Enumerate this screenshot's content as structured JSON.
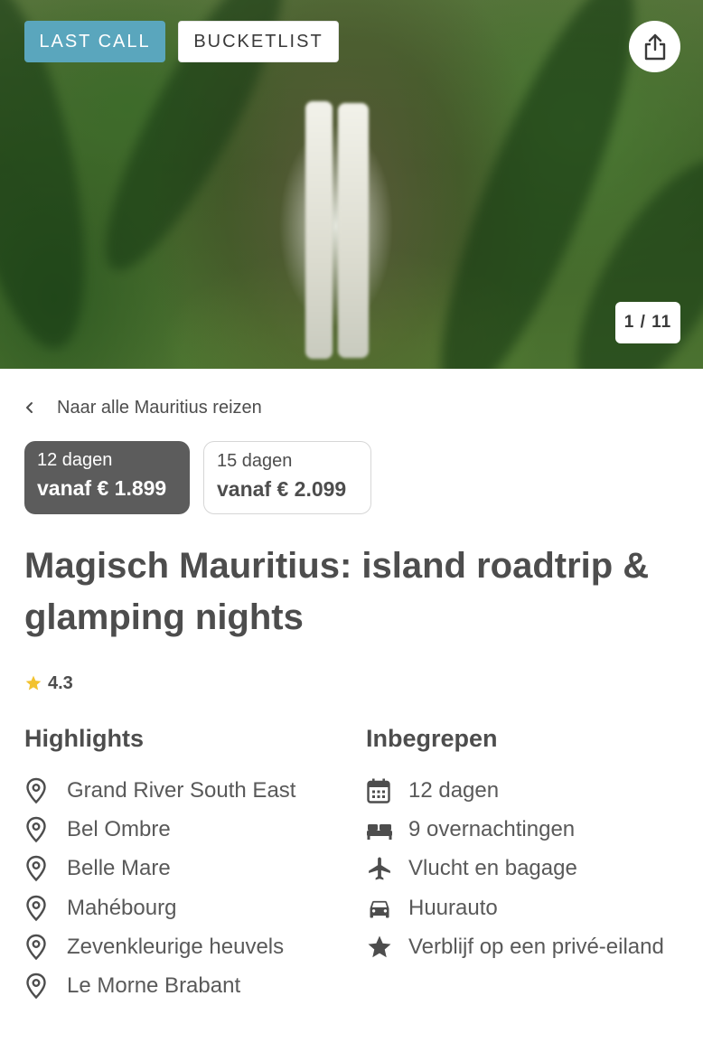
{
  "hero": {
    "tags": [
      "LAST CALL",
      "BUCKETLIST"
    ],
    "counter": "1 / 11",
    "share_icon": "share-icon"
  },
  "back_link": {
    "label": "Naar alle Mauritius reizen",
    "icon": "chevron-left-icon"
  },
  "durations": [
    {
      "days": "12 dagen",
      "price": "vanaf € 1.899",
      "selected": true
    },
    {
      "days": "15 dagen",
      "price": "vanaf € 2.099",
      "selected": false
    }
  ],
  "title": "Magisch Mauritius: island roadtrip & glamping nights",
  "rating": {
    "value": "4.3",
    "icon": "star-icon",
    "color": "#f2c230"
  },
  "highlights": {
    "heading": "Highlights",
    "icon": "location-pin-icon",
    "items": [
      "Grand River South East",
      "Bel Ombre",
      "Belle Mare",
      "Mahébourg",
      "Zevenkleurige heuvels",
      "Le Morne Brabant"
    ]
  },
  "included": {
    "heading": "Inbegrepen",
    "items": [
      {
        "label": "12 dagen",
        "icon": "calendar-icon"
      },
      {
        "label": "9 overnachtingen",
        "icon": "bed-icon"
      },
      {
        "label": "Vlucht en bagage",
        "icon": "airplane-icon"
      },
      {
        "label": "Huurauto",
        "icon": "car-icon"
      },
      {
        "label": "Verblijf op een privé-eiland",
        "icon": "star-icon"
      }
    ]
  },
  "colors": {
    "last_call": "#5aa6bd",
    "selected_option": "#5c5c5c",
    "text": "#4d4d4d"
  }
}
